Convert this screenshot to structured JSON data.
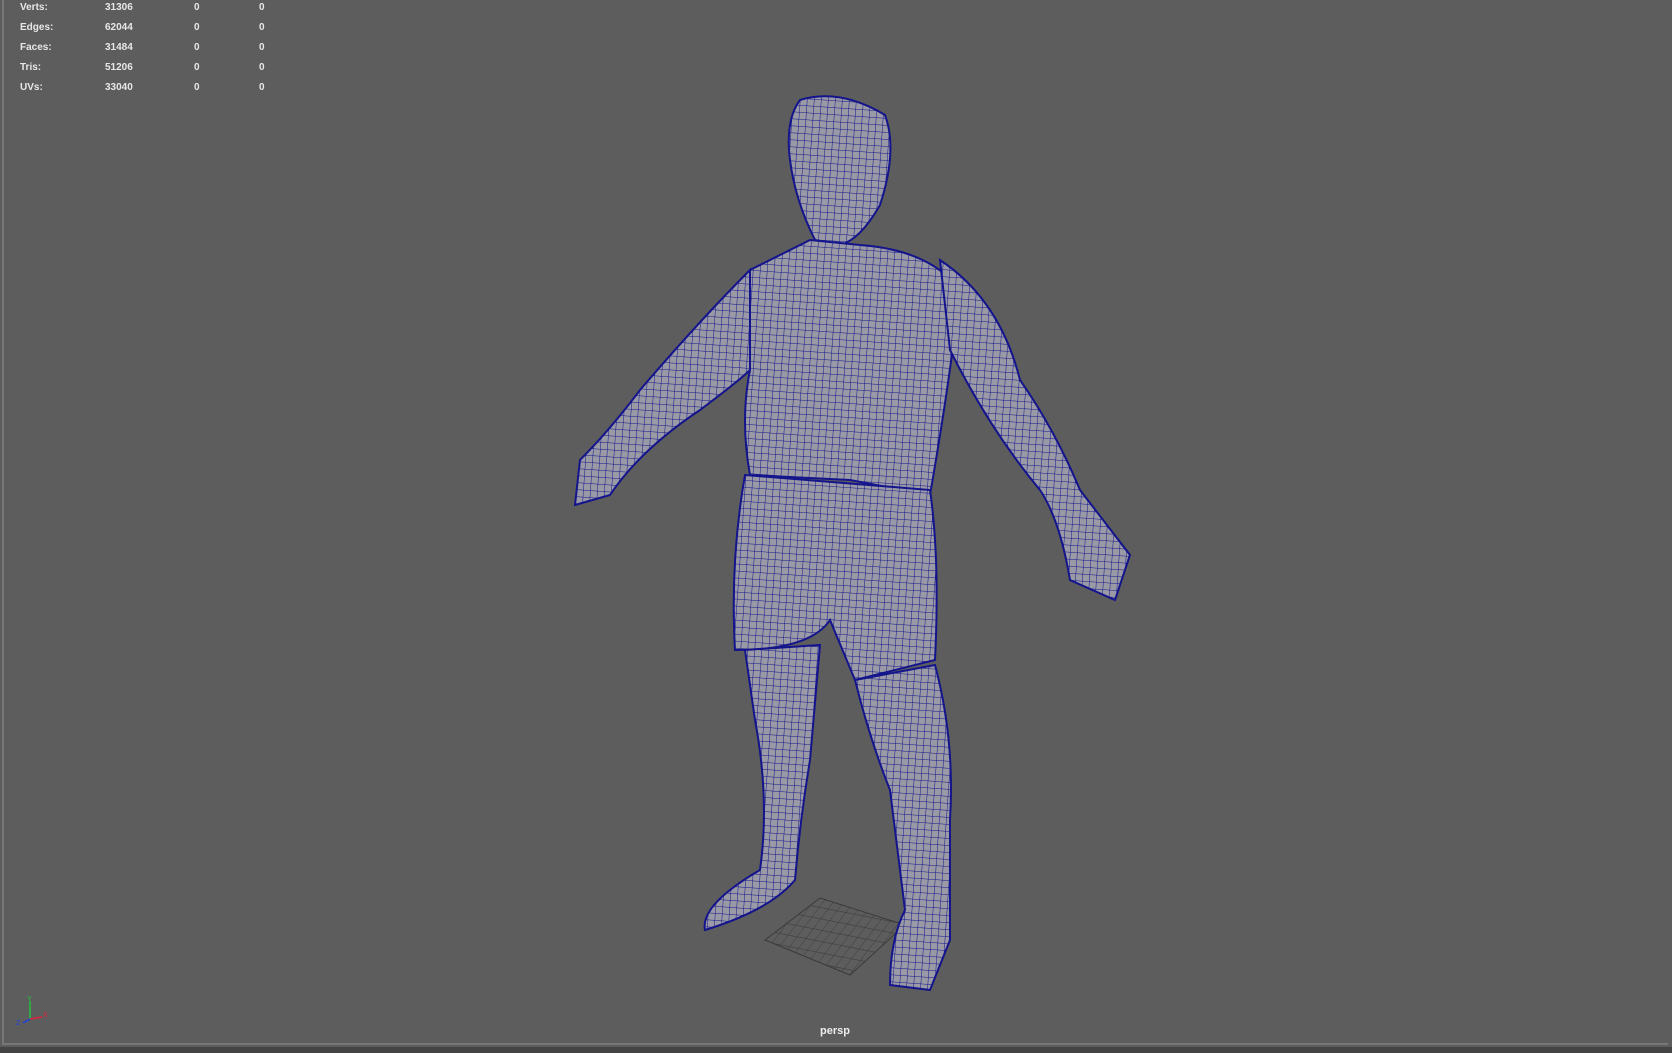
{
  "hud": {
    "rows": [
      {
        "label": "Verts:",
        "value": "31306",
        "selected": "0",
        "component": "0"
      },
      {
        "label": "Edges:",
        "value": "62044",
        "selected": "0",
        "component": "0"
      },
      {
        "label": "Faces:",
        "value": "31484",
        "selected": "0",
        "component": "0"
      },
      {
        "label": "Tris:",
        "value": "51206",
        "selected": "0",
        "component": "0"
      },
      {
        "label": "UVs:",
        "value": "33040",
        "selected": "0",
        "component": "0"
      }
    ]
  },
  "camera": {
    "name": "persp"
  },
  "axis": {
    "x": "X",
    "y": "Y",
    "z": "Z"
  },
  "colors": {
    "viewport_bg": "#5d5d5d",
    "wireframe": "#14148c",
    "mesh": "#9a9aa6",
    "axis_x": "#e0203c",
    "axis_y": "#20c040",
    "axis_z": "#2040e0"
  }
}
